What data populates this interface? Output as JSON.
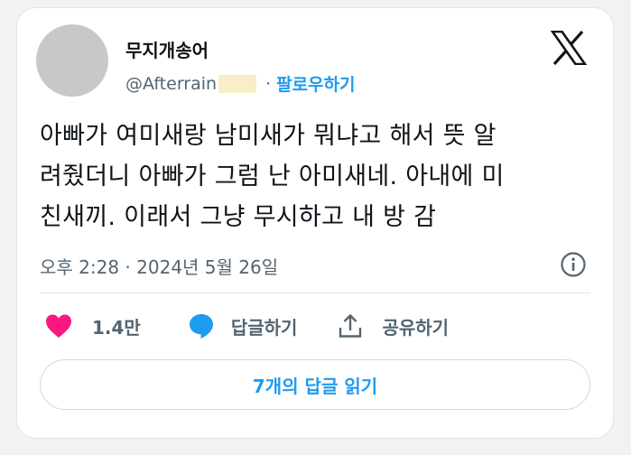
{
  "author": {
    "display_name": "무지개송어",
    "handle": "@Afterrain",
    "separator": "·",
    "follow_label": "팔로우하기"
  },
  "tweet": {
    "lines": [
      "아빠가 여미새랑 남미새가 뭐냐고 해서 뜻 알",
      "려줬더니 아빠가 그럼 난 아미새네. 아내에 미",
      "친새끼. 이래서 그냥 무시하고 내 방 감"
    ],
    "timestamp": "오후 2:28 · 2024년 5월 26일"
  },
  "actions": {
    "likes": "1.4만",
    "reply_label": "답글하기",
    "share_label": "공유하기"
  },
  "read_replies_label": "7개의 답글 읽기",
  "icons": {
    "logo": "x-logo-icon",
    "info": "info-icon",
    "like": "heart-icon",
    "reply": "speech-bubble-icon",
    "share": "share-icon"
  },
  "colors": {
    "accent": "#1d9bf0",
    "like": "#f91880",
    "text": "#0f1419",
    "muted": "#536471"
  }
}
